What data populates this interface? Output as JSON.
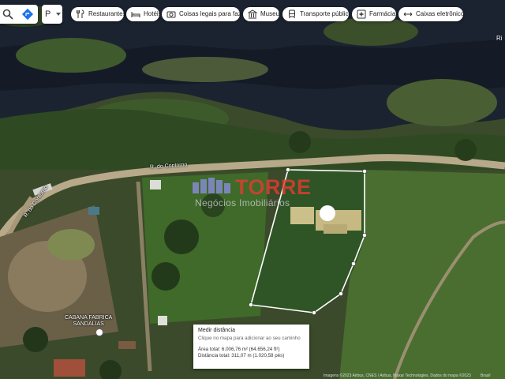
{
  "toolbar": {
    "lang_value": "P",
    "chips": [
      {
        "label": "Restaurantes",
        "icon": "restaurant-icon"
      },
      {
        "label": "Hotéis",
        "icon": "hotel-icon"
      },
      {
        "label": "Coisas legais para fazer",
        "icon": "camera-icon"
      },
      {
        "label": "Museus",
        "icon": "museum-icon"
      },
      {
        "label": "Transporte público",
        "icon": "transit-icon"
      },
      {
        "label": "Farmácias",
        "icon": "pharmacy-icon"
      },
      {
        "label": "Caixas eletrônicos",
        "icon": "atm-icon"
      }
    ]
  },
  "map": {
    "road_labels": [
      "R. do Contorno",
      "R. do Contorno"
    ],
    "place": {
      "line1": "CABANA FABRICA",
      "line2": "SANDALIAS"
    },
    "edge_text": "Ri",
    "colors": {
      "road": "#b8a98a",
      "measure_line": "#ffffff",
      "watermark_red": "#e03c32"
    }
  },
  "watermark": {
    "title": "TORRE",
    "subtitle": "Negócios Imobiliários"
  },
  "measure": {
    "title": "Medir distância",
    "hint": "Clique no mapa para adicionar ao seu caminho",
    "area": "Área total: 6.006,76 m² (64.656,24 ft²)",
    "distance": "Distância total: 311,07 m (1.020,58 pés)"
  },
  "footer": {
    "attribution": "Imagens ©2023 Airbus, CNES / Airbus, Maxar Technologies, Dados do mapa ©2023",
    "scale_text": "Brasil"
  }
}
